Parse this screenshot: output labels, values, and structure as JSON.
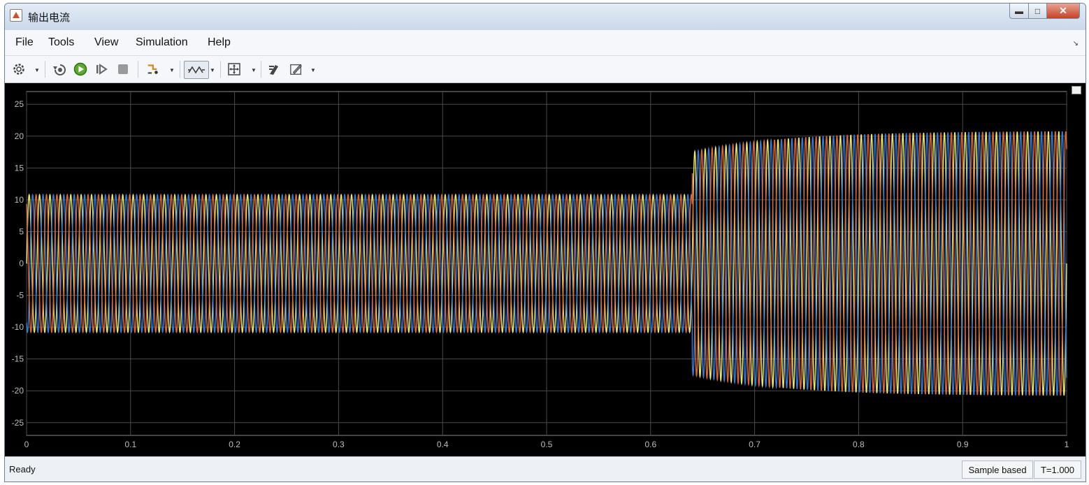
{
  "window": {
    "title": "输出电流"
  },
  "menu": {
    "items": [
      "File",
      "Tools",
      "View",
      "Simulation",
      "Help"
    ]
  },
  "toolbar": {
    "icons": [
      "settings-gear-icon",
      "step-back-icon",
      "run-icon",
      "step-forward-icon",
      "stop-icon",
      "highlight-icon",
      "zoom-icon",
      "fit-to-view-icon",
      "signal-select-icon",
      "style-icon"
    ]
  },
  "status": {
    "text": "Ready",
    "mode": "Sample based",
    "time": "T=1.000"
  },
  "colors": {
    "background": "#000000",
    "grid": "#4b4b4b",
    "tick_text": "#bdbdbd",
    "phase_a": "#e6e37a",
    "phase_b": "#3c78c8",
    "phase_c": "#d2693c"
  },
  "chart_data": {
    "type": "line",
    "title": "",
    "xlabel": "",
    "ylabel": "",
    "xlim": [
      0,
      1
    ],
    "ylim": [
      -27,
      27
    ],
    "xticks": [
      "0",
      "0.1",
      "0.2",
      "0.3",
      "0.4",
      "0.5",
      "0.6",
      "0.7",
      "0.8",
      "0.9",
      "1"
    ],
    "yticks": [
      "25",
      "20",
      "15",
      "10",
      "5",
      "0",
      "-5",
      "-10",
      "-15",
      "-20",
      "-25"
    ],
    "grid": true,
    "legend": "none",
    "approx_frequency_hz": 100,
    "series": [
      {
        "color": "#e6e37a",
        "phase_deg": 0,
        "segments": [
          {
            "t_start": 0,
            "t_end": 0.64,
            "amplitude": 10.8
          },
          {
            "t_start": 0.64,
            "t_end": 1.0,
            "amplitude_start": 17.5,
            "amplitude_end": 20.8
          }
        ]
      },
      {
        "color": "#3c78c8",
        "phase_deg": 120,
        "segments": [
          {
            "t_start": 0,
            "t_end": 0.64,
            "amplitude": 10.8
          },
          {
            "t_start": 0.64,
            "t_end": 1.0,
            "amplitude_start": 17.5,
            "amplitude_end": 20.8
          }
        ]
      },
      {
        "color": "#d2693c",
        "phase_deg": 240,
        "segments": [
          {
            "t_start": 0,
            "t_end": 0.64,
            "amplitude": 10.8
          },
          {
            "t_start": 0.64,
            "t_end": 1.0,
            "amplitude_start": 17.5,
            "amplitude_end": 20.8
          }
        ]
      }
    ]
  }
}
